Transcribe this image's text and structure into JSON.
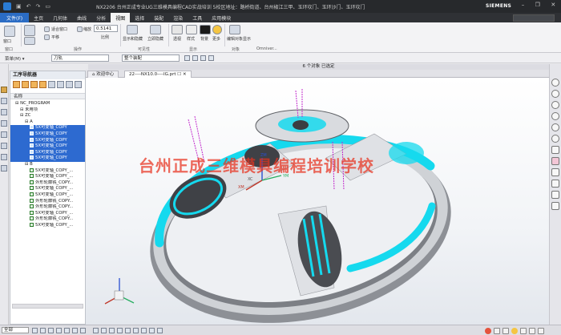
{
  "window": {
    "title": "NX2206 台州正成专业UG三维模具编程CAD实战培训   5校区地址：路桥街道、台州椒江三甲、玉环坎门、玉环沙门、玉环坎门",
    "brand": "SIEMENS",
    "controls": [
      "–",
      "❐",
      "✕"
    ],
    "qat_icons": [
      "save-icon",
      "undo-icon",
      "redo-icon",
      "window-icon"
    ]
  },
  "menu": {
    "items": [
      "文件(F)",
      "主页",
      "几何体",
      "曲线",
      "分析",
      "视图",
      "选择",
      "装配",
      "渲染",
      "工具",
      "应用模块"
    ],
    "active": "视图"
  },
  "ribbon": {
    "buttons": {
      "window": "窗口",
      "fit_window": "适合窗口",
      "pan": "平移",
      "scale_label": "缩放",
      "scale_value": "0.5141",
      "ratio": "比例",
      "show_hide": "显示和隐藏",
      "immediate_hide": "立即隐藏",
      "perspective": "透视",
      "style": "样式",
      "background": "背景",
      "more": "更多",
      "edit_object_display": "编辑对象显示",
      "omniverse": "Omniver..."
    },
    "groups": [
      "窗口",
      "操作",
      "可见性",
      "显示",
      "对象"
    ]
  },
  "toolbar2": {
    "menu_label": "菜单(M) ▾",
    "filter_value": "刀轨",
    "scope_value": "整个装配",
    "object_count": "6 个对象 已选定"
  },
  "navigator": {
    "title": "工序导航器",
    "column_header": "名称",
    "tree": [
      {
        "label": "NC_PROGRAM",
        "indent": 1,
        "type": "root",
        "selected": false
      },
      {
        "label": "未用项",
        "indent": 2,
        "type": "folder",
        "selected": false
      },
      {
        "label": "ZC",
        "indent": 2,
        "type": "folder",
        "selected": false
      },
      {
        "label": "A",
        "indent": 3,
        "type": "folder",
        "selected": false
      },
      {
        "label": "5X可变轴_COPY",
        "indent": 4,
        "type": "op",
        "selected": true
      },
      {
        "label": "5X可变轴_COPY",
        "indent": 4,
        "type": "op",
        "selected": true
      },
      {
        "label": "5X可变轴_COPY",
        "indent": 4,
        "type": "op",
        "selected": true
      },
      {
        "label": "5X可变轴_COPY",
        "indent": 4,
        "type": "op",
        "selected": true
      },
      {
        "label": "5X可变轴_COPY",
        "indent": 4,
        "type": "op",
        "selected": true
      },
      {
        "label": "5X可变轴_COPY",
        "indent": 4,
        "type": "op",
        "selected": true
      },
      {
        "label": "B",
        "indent": 3,
        "type": "folder",
        "selected": false
      },
      {
        "label": "5X可变轴_COPY_...",
        "indent": 4,
        "type": "op",
        "selected": false
      },
      {
        "label": "5X可变轴_COPY_...",
        "indent": 4,
        "type": "op",
        "selected": false
      },
      {
        "label": "外形轮廓铣_COPY...",
        "indent": 4,
        "type": "op",
        "selected": false
      },
      {
        "label": "5X可变轴_COPY_...",
        "indent": 4,
        "type": "op",
        "selected": false
      },
      {
        "label": "5X可变轴_COPY_...",
        "indent": 4,
        "type": "op",
        "selected": false
      },
      {
        "label": "外形轮廓铣_COPY...",
        "indent": 4,
        "type": "op",
        "selected": false
      },
      {
        "label": "外形轮廓铣_COPY...",
        "indent": 4,
        "type": "op",
        "selected": false
      },
      {
        "label": "5X可变轴_COPY_...",
        "indent": 4,
        "type": "op",
        "selected": false
      },
      {
        "label": "外形轮廓铣_COPY...",
        "indent": 4,
        "type": "op",
        "selected": false
      },
      {
        "label": "5X可变轴_COPY_...",
        "indent": 4,
        "type": "op",
        "selected": false
      }
    ]
  },
  "tabs": [
    {
      "label": "⌂ 欢迎中心",
      "active": false
    },
    {
      "label": "22----NX10.0----IG.prt ☐ ✕",
      "active": true
    }
  ],
  "viewport": {
    "watermark": "台州正成三维模具编程培训学校",
    "axis_labels": {
      "zm": "ZM",
      "ym": "YM",
      "xm": "XM",
      "xc": "XC"
    },
    "highlight_color": "#15d9ee",
    "toolpath_color": "#c22ccc"
  },
  "status_bar": {
    "dropdown_value": "全部",
    "tray_icons": [
      "sogou-icon",
      "chinese-mode-icon",
      "punctuation-icon",
      "emoji-icon",
      "keyboard-icon",
      "microphone-icon",
      "settings-icon"
    ]
  },
  "right_bar_icons": [
    "chrome-icon",
    "history-icon",
    "roles-icon",
    "system-material-icon",
    "part-navigator-icon",
    "assembly-navigator-icon",
    "constraint-icon",
    "reuse-library-icon",
    "hd3d-icon",
    "web-browser-icon",
    "palette-icon",
    "process-studio-icon"
  ]
}
